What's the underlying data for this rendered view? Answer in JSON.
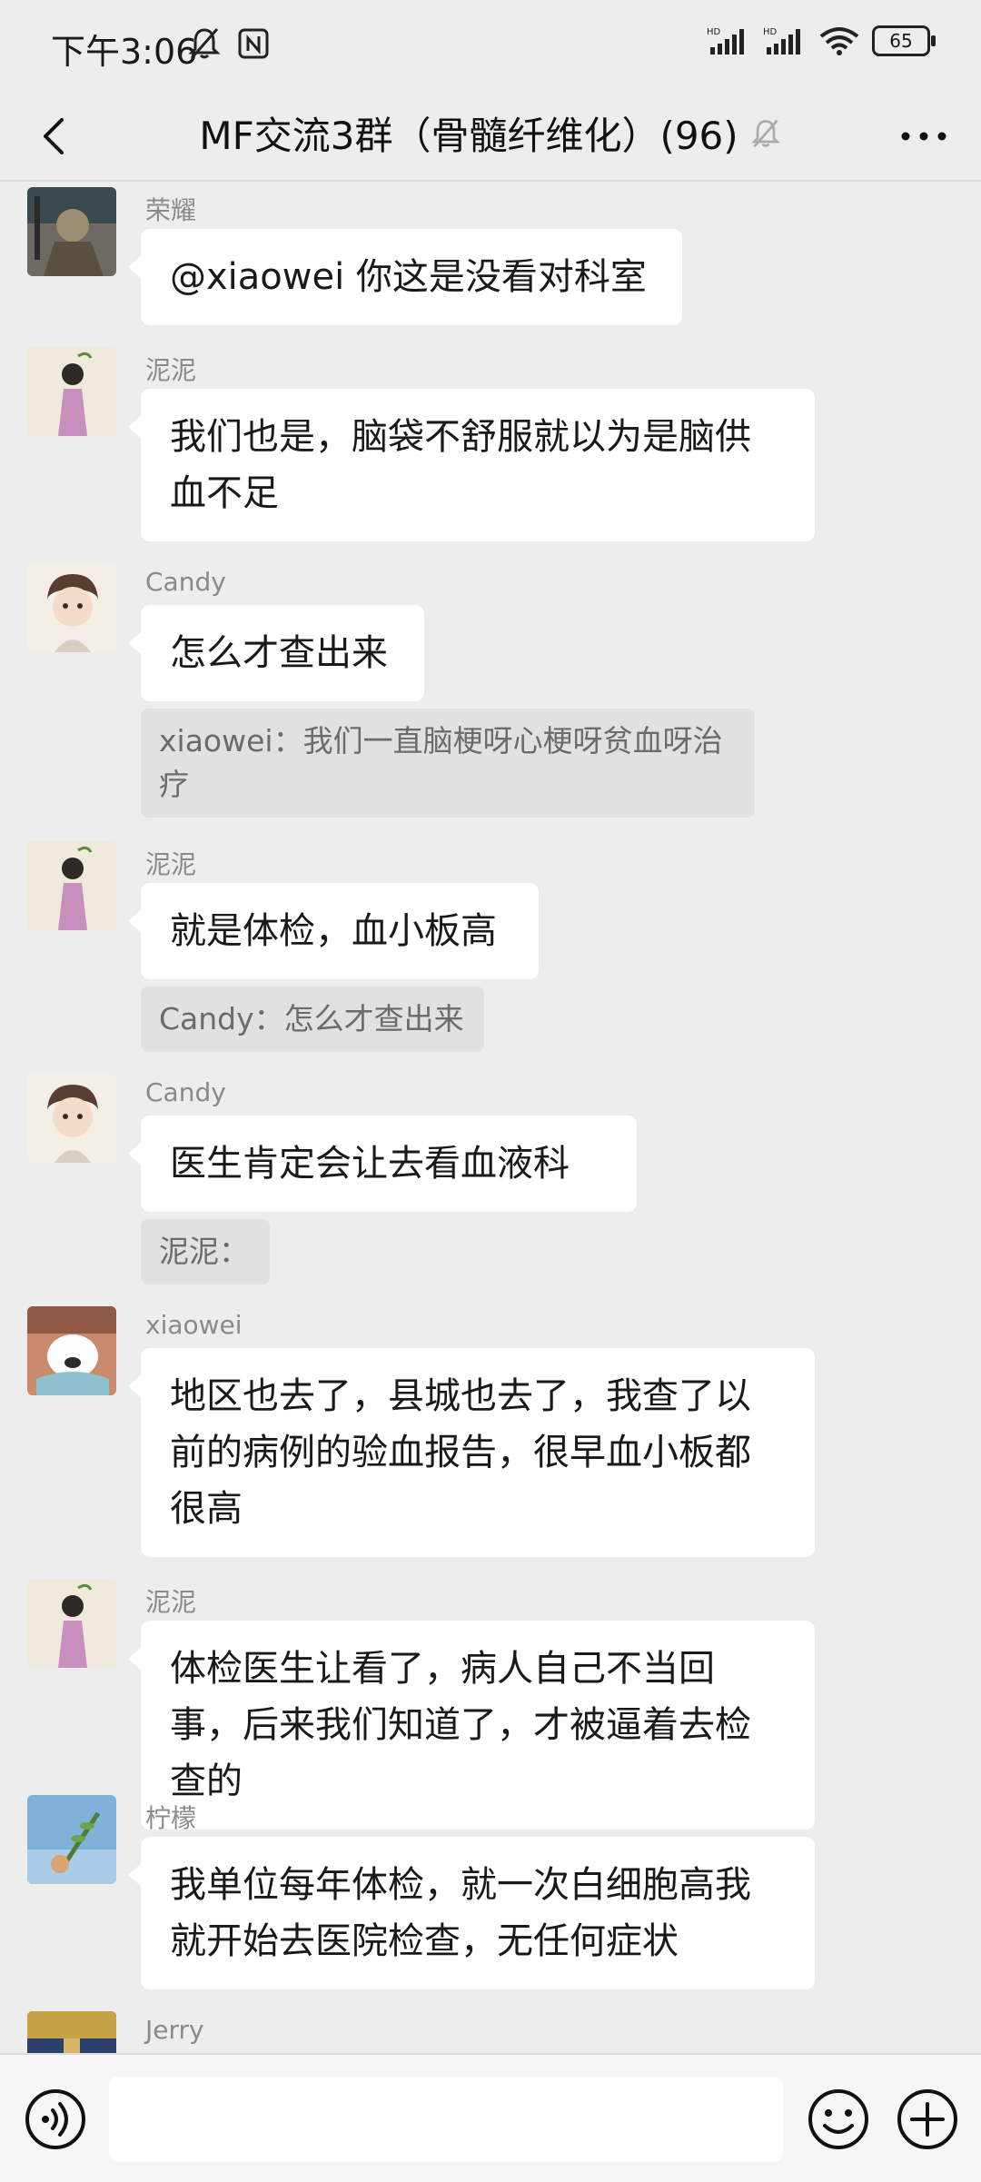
{
  "status_bar": {
    "time": "下午3:06",
    "battery": "65"
  },
  "header": {
    "title": "MF交流3群（骨髓纤维化）(96)"
  },
  "messages": [
    {
      "sender": "荣耀",
      "text": "@xiaowei  你这是没看对科室"
    },
    {
      "sender": "泥泥",
      "text": "我们也是，脑袋不舒服就以为是脑供血不足"
    },
    {
      "sender": "Candy",
      "text": "怎么才查出来",
      "quote": "xiaowei：我们一直脑梗呀心梗呀贫血呀治疗"
    },
    {
      "sender": "泥泥",
      "text": "就是体检，血小板高",
      "quote": "Candy：怎么才查出来"
    },
    {
      "sender": "Candy",
      "text": "医生肯定会让去看血液科",
      "quote": "泥泥："
    },
    {
      "sender": "xiaowei",
      "text": "地区也去了，县城也去了，我查了以前的病例的验血报告，很早血小板都很高"
    },
    {
      "sender": "泥泥",
      "text": "体检医生让看了，病人自己不当回事，后来我们知道了，才被逼着去检查的"
    },
    {
      "sender": "柠檬",
      "text": "我单位每年体检，就一次白细胞高我就开始去医院检查，无任何症状"
    },
    {
      "sender": "Jerry"
    }
  ],
  "input_bar": {
    "voice_icon": "voice-icon",
    "emoji_icon": "emoji-icon",
    "plus_icon": "plus-icon",
    "input_value": ""
  }
}
